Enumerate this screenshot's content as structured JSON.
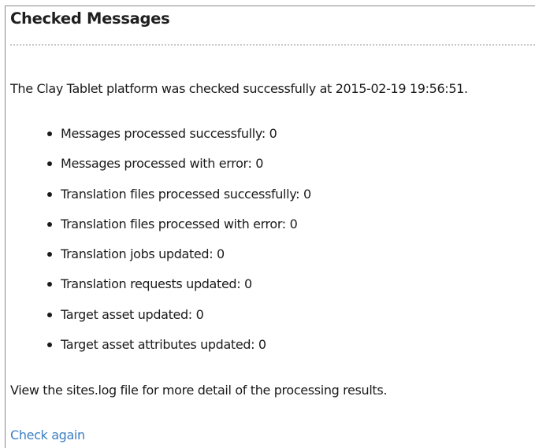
{
  "panel": {
    "title": "Checked Messages",
    "summary": "The Clay Tablet platform was checked successfully at 2015-02-19 19:56:51.",
    "stats": [
      {
        "label": "Messages processed successfully: 0"
      },
      {
        "label": "Messages processed with error: 0"
      },
      {
        "label": "Translation files processed successfully: 0"
      },
      {
        "label": "Translation files processed with error: 0"
      },
      {
        "label": "Translation jobs updated: 0"
      },
      {
        "label": "Translation requests updated: 0"
      },
      {
        "label": "Target asset updated: 0"
      },
      {
        "label": "Target asset attributes updated: 0"
      }
    ],
    "footer_note": "View the sites.log file for more detail of the processing results.",
    "check_again_link": "Check again",
    "colors": {
      "link": "#3b7fc4",
      "border": "#8a8a8a",
      "divider": "#c9c9c9"
    }
  }
}
